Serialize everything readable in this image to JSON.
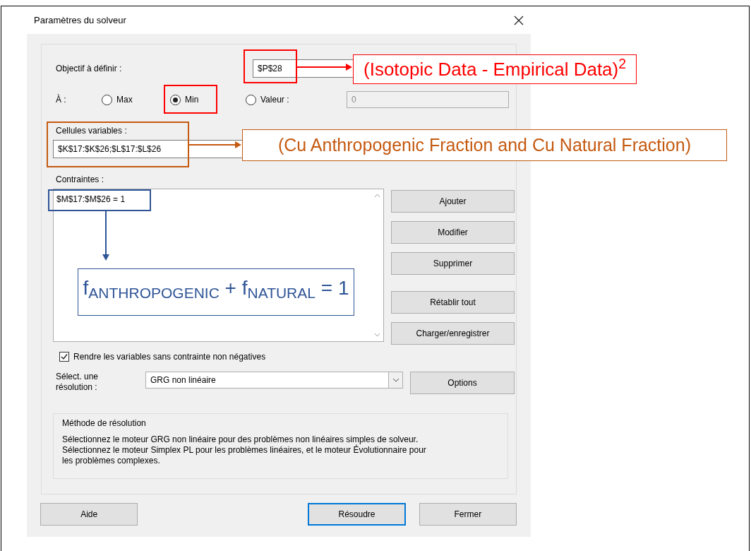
{
  "window": {
    "title": "Paramètres du solveur"
  },
  "objective": {
    "label": "Objectif à définir :",
    "value": "$P$28"
  },
  "target": {
    "label": "À :",
    "options": [
      {
        "label": "Max",
        "selected": false
      },
      {
        "label": "Min",
        "selected": true
      },
      {
        "label": "Valeur :",
        "selected": false
      }
    ],
    "value_field": {
      "value": "0",
      "disabled": true
    }
  },
  "variable_cells": {
    "label": "Cellules variables :",
    "value": "$K$17:$K$26;$L$17:$L$26"
  },
  "constraints": {
    "label": "Contraintes :",
    "items": [
      "$M$17:$M$26 = 1"
    ]
  },
  "side_buttons": [
    "Ajouter",
    "Modifier",
    "Supprimer",
    "Rétablir tout",
    "Charger/enregistrer"
  ],
  "non_negative": {
    "label": "Rendre les variables sans contrainte non négatives",
    "checked": true
  },
  "solving_method": {
    "label": "Sélect. une résolution :",
    "value": "GRG non linéaire",
    "options_button": "Options"
  },
  "method_group": {
    "title": "Méthode de résolution",
    "text": "Sélectionnez le moteur GRG non linéaire pour des problèmes non linéaires simples de solveur. Sélectionnez le moteur Simplex PL pour les problèmes linéaires, et le moteur Évolutionnaire pour les problèmes complexes."
  },
  "footer_buttons": [
    {
      "label": "Aide",
      "default": false
    },
    {
      "label": "Résoudre",
      "default": true
    },
    {
      "label": "Fermer",
      "default": false
    }
  ],
  "annotations": [
    {
      "label": "(Isotopic Data - Empirical Data)$^{2}$",
      "color": "#ff0000"
    },
    {
      "label": "(Cu Anthropogenic Fraction and Cu Natural Fraction)",
      "color": "#c55a11"
    },
    {
      "label": "f$_{ANTHROPOGENIC}$ + f$_{NATURAL}$ = 1",
      "color": "#2f5597"
    }
  ]
}
